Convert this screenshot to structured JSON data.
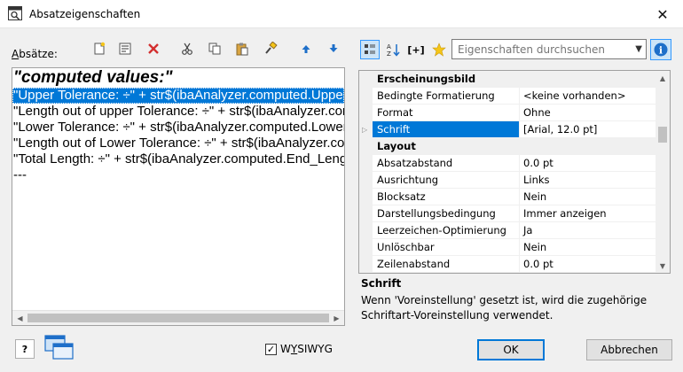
{
  "window": {
    "title": "Absatzeigenschaften",
    "close_glyph": "✕"
  },
  "left": {
    "label_prefix": "A",
    "label_rest": "bsätze:",
    "toolbar_icons": [
      "new-paragraph-icon",
      "properties-icon",
      "delete-icon",
      "cut-icon",
      "copy-icon",
      "paste-icon",
      "format-painter-icon",
      "move-up-icon",
      "move-down-icon"
    ],
    "lines": [
      "\"computed values:\"",
      "\"Upper Tolerance: ÷\" + str$(ibaAnalyzer.computed.Upper_Tolerance)",
      "\"Length out of upper Tolerance: ÷\" + str$(ibaAnalyzer.computed.Length_out_of_upper)",
      "\"Lower Tolerance: ÷\" + str$(ibaAnalyzer.computed.Lower_Tolerance)",
      "\"Length out of Lower Tolerance: ÷\" + str$(ibaAnalyzer.computed.Length_out_of_lower)",
      "\"Total Length: ÷\" + str$(ibaAnalyzer.computed.End_Length)",
      "---"
    ]
  },
  "right": {
    "toolbar_icons": [
      "categorized-icon",
      "alphabetical-icon",
      "expression-icon",
      "favorites-star-icon"
    ],
    "expression_label": "[+]",
    "search_placeholder": "Eigenschaften durchsuchen",
    "info_glyph": "i",
    "categories": {
      "appearance": "Erscheinungsbild",
      "layout": "Layout"
    },
    "appearance_rows": [
      {
        "name": "Bedingte Formatierung",
        "value": "<keine vorhanden>"
      },
      {
        "name": "Format",
        "value": "Ohne"
      },
      {
        "name": "Schrift",
        "value": "[Arial, 12.0 pt]"
      }
    ],
    "layout_rows": [
      {
        "name": "Absatzabstand",
        "value": "0.0 pt"
      },
      {
        "name": "Ausrichtung",
        "value": "Links"
      },
      {
        "name": "Blocksatz",
        "value": "Nein"
      },
      {
        "name": "Darstellungsbedingung",
        "value": "Immer anzeigen"
      },
      {
        "name": "Leerzeichen-Optimierung",
        "value": "Ja"
      },
      {
        "name": "Unlöschbar",
        "value": "Nein"
      },
      {
        "name": "Zeilenabstand",
        "value": "0.0 pt"
      }
    ],
    "description_title": "Schrift",
    "description_text": "Wenn 'Voreinstellung' gesetzt ist, wird die zugehörige Schriftart-Voreinstellung verwendet."
  },
  "footer": {
    "help_glyph": "?",
    "wysiwyg_prefix": "W",
    "wysiwyg_underlined": "Y",
    "wysiwyg_rest": "SIWYG",
    "wysiwyg_checked": true,
    "check_glyph": "✓",
    "ok_label": "OK",
    "cancel_label": "Abbrechen"
  }
}
